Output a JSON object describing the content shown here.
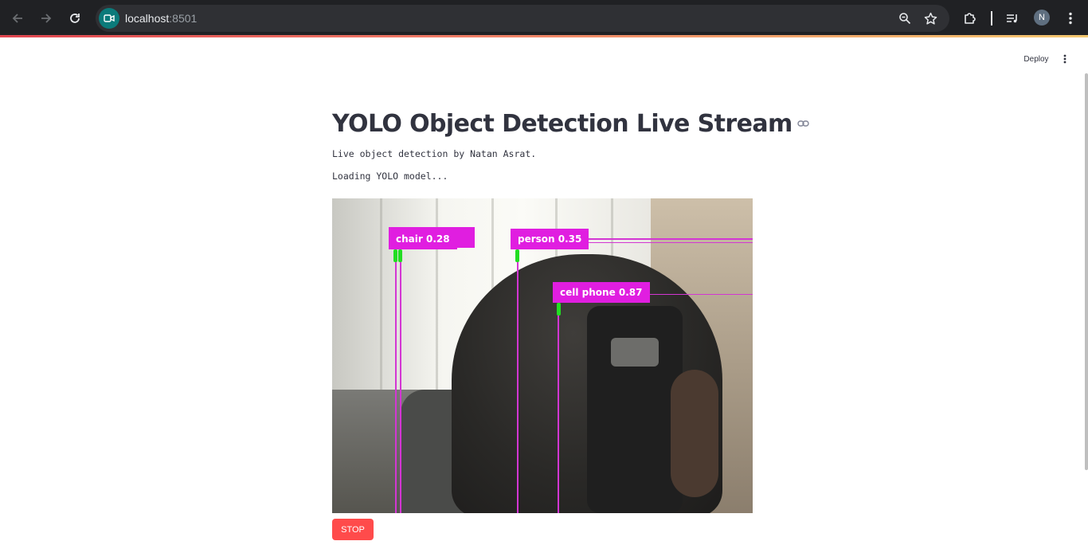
{
  "browser": {
    "url_host": "localhost",
    "url_port": ":8501",
    "profile_initial": "N",
    "icons": {
      "back": "arrow-left-icon",
      "forward": "arrow-right-icon",
      "reload": "reload-icon",
      "site": "video-camera-icon",
      "zoom": "zoom-icon",
      "bookmark": "star-icon",
      "extensions": "puzzle-icon",
      "media": "playlist-icon",
      "menu": "kebab-menu-icon"
    }
  },
  "app_header": {
    "deploy_label": "Deploy",
    "menu_icon": "kebab-menu-icon"
  },
  "main": {
    "title": "YOLO Object Detection Live Stream",
    "subtitle": "Live object detection by Natan Asrat.",
    "status": "Loading YOLO model...",
    "video": {
      "detections": [
        {
          "label": "chair 0.28",
          "color": "#e01ee0"
        },
        {
          "label": "person 0.35",
          "color": "#e01ee0"
        },
        {
          "label": "cell phone 0.87",
          "color": "#e01ee0"
        }
      ]
    },
    "stop_label": "STOP"
  },
  "colors": {
    "chrome_bg": "#202124",
    "accent_red": "#ff4b4b",
    "text": "#31333f",
    "detection_box": "#e01ee0"
  }
}
